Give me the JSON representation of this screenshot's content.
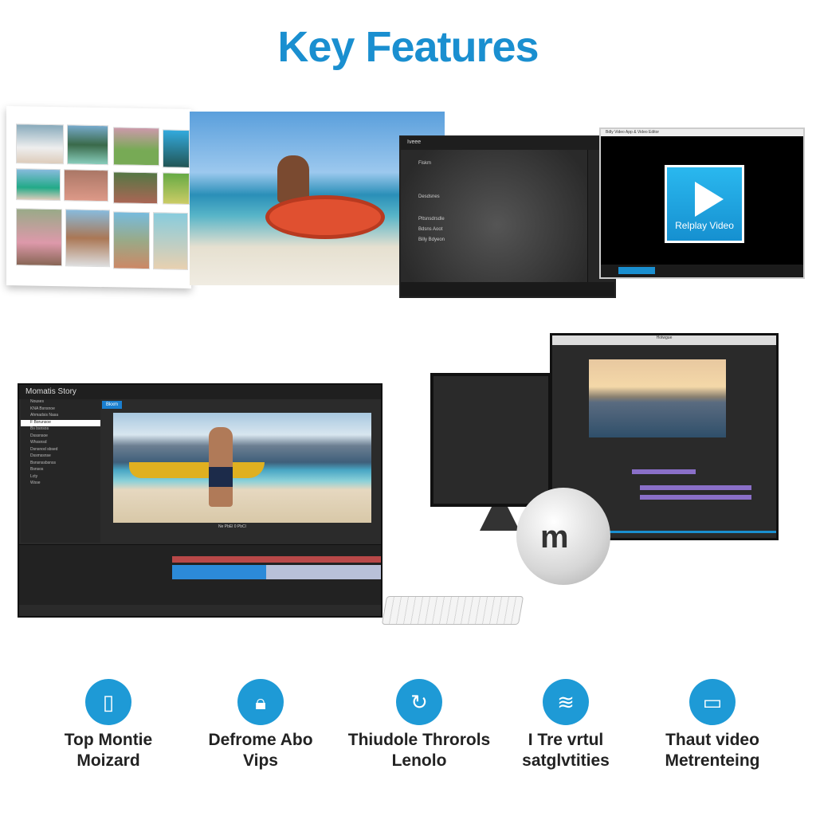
{
  "title": "Key Features",
  "top_row": {
    "dark_app": {
      "title": "Iveee",
      "items": [
        "Fiskm",
        "Desdsnes",
        "Pltsnsdrsdle",
        "Bdsns Aoot",
        "Billy Bdyeon"
      ]
    },
    "player": {
      "window_title": "Bdly Video App & Video Editor",
      "button_label": "Relplay Video",
      "accent": "#1a8fd0"
    }
  },
  "editor": {
    "title": "Momatis Story",
    "tab": "Bkxm",
    "tree": [
      "Nouses",
      "KNA Bsnsnoe",
      "Ahmadsis Nasa",
      "F Borunsoe",
      "Bs bsnsos",
      "Dsssnsoe",
      "Whssnsd",
      "Dsnsnod sbsed",
      "Dssmssnse",
      "Bsnsnssbsnss",
      "Bsnsos",
      "Lcty",
      "Wsse"
    ],
    "timecode": "Ne PbEl 0 PbCl"
  },
  "monitor": {
    "title": "Hotwgue"
  },
  "features": [
    {
      "icon": "phone-icon",
      "line1": "Top Montie",
      "line2": "Moizard"
    },
    {
      "icon": "lock-icon",
      "line1": "Defrome Abo",
      "line2": "Vips"
    },
    {
      "icon": "refresh-icon",
      "line1": "Thiudole Throrols",
      "line2": "Lenolo"
    },
    {
      "icon": "signal-icon",
      "line1": "I Tre vrtul",
      "line2": "satglvtities"
    },
    {
      "icon": "laptop-icon",
      "line1": "Thaut video",
      "line2": "Metrenteing"
    }
  ],
  "colors": {
    "title": "#1a8fd0",
    "icon_circle": "#1e9ad6"
  }
}
